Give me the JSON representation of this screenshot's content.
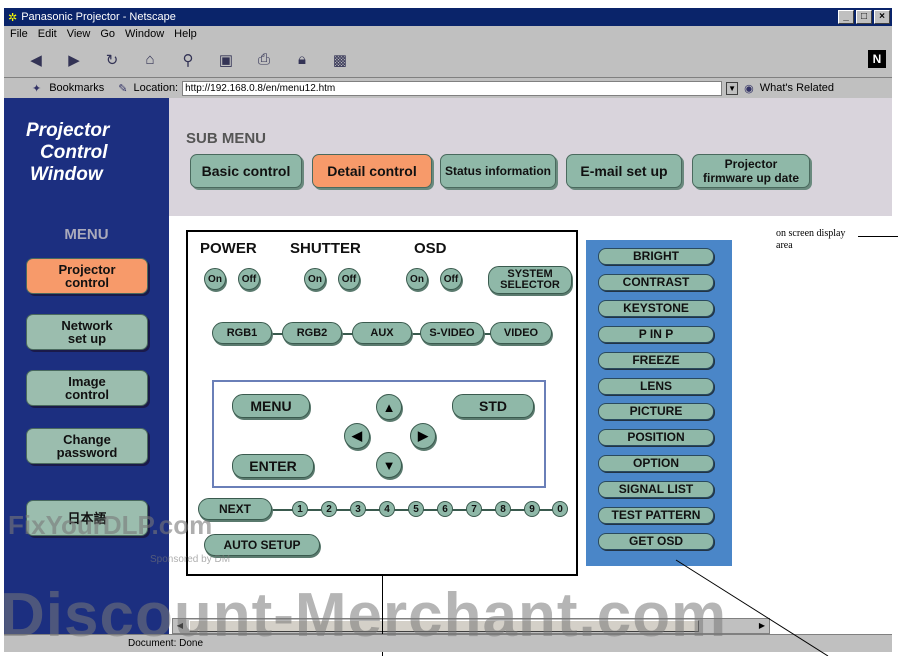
{
  "window": {
    "title": "Panasonic Projector - Netscape",
    "min": "_",
    "max": "□",
    "close": "×"
  },
  "menubar": [
    "File",
    "Edit",
    "View",
    "Go",
    "Window",
    "Help"
  ],
  "toolbar": {
    "netscape_logo": "N",
    "icons": [
      "back-icon",
      "forward-icon",
      "reload-icon",
      "home-icon",
      "search-icon",
      "netscape-icon",
      "print-icon",
      "security-icon",
      "stop-icon"
    ]
  },
  "locationbar": {
    "bookmarks": "Bookmarks",
    "location_label": "Location:",
    "url": "http://192.168.0.8/en/menu12.htm",
    "whats_related": "What's Related"
  },
  "header": {
    "logo_lines": [
      "Projector",
      "Control",
      "Window"
    ],
    "submenu_label": "SUB MENU",
    "subtabs": [
      "Basic control",
      "Detail control",
      "Status information",
      "E-mail set up",
      "Projector firmware up date"
    ],
    "active_subtab": "Detail control"
  },
  "sidebar": {
    "title": "MENU",
    "items": [
      "Projector control",
      "Network set up",
      "Image control",
      "Change password",
      "日本語"
    ],
    "active": "Projector control"
  },
  "panel": {
    "power": "POWER",
    "shutter": "SHUTTER",
    "osd": "OSD",
    "on": "On",
    "off": "Off",
    "system_selector": "SYSTEM SELECTOR",
    "inputs": [
      "RGB1",
      "RGB2",
      "AUX",
      "S-VIDEO",
      "VIDEO"
    ],
    "menu": "MENU",
    "std": "STD",
    "enter": "ENTER",
    "next": "NEXT",
    "numbers": [
      "1",
      "2",
      "3",
      "4",
      "5",
      "6",
      "7",
      "8",
      "9",
      "0"
    ],
    "auto_setup": "AUTO SETUP"
  },
  "right_buttons": [
    "BRIGHT",
    "CONTRAST",
    "KEYSTONE",
    "P IN P",
    "FREEZE",
    "LENS",
    "PICTURE",
    "POSITION",
    "OPTION",
    "SIGNAL LIST",
    "TEST PATTERN",
    "GET OSD"
  ],
  "osd_area_label": "on screen display area",
  "status": "Document: Done",
  "watermarks": {
    "main": "Discount-Merchant.com",
    "fix": "FixYourDLP.com",
    "sponsored": "Sponsored by DM"
  },
  "colors": {
    "button_green": "#8fb8a8",
    "active_orange": "#f79a6a",
    "sidebar_navy": "#1c2f80",
    "right_panel_blue": "#4a86c8"
  }
}
